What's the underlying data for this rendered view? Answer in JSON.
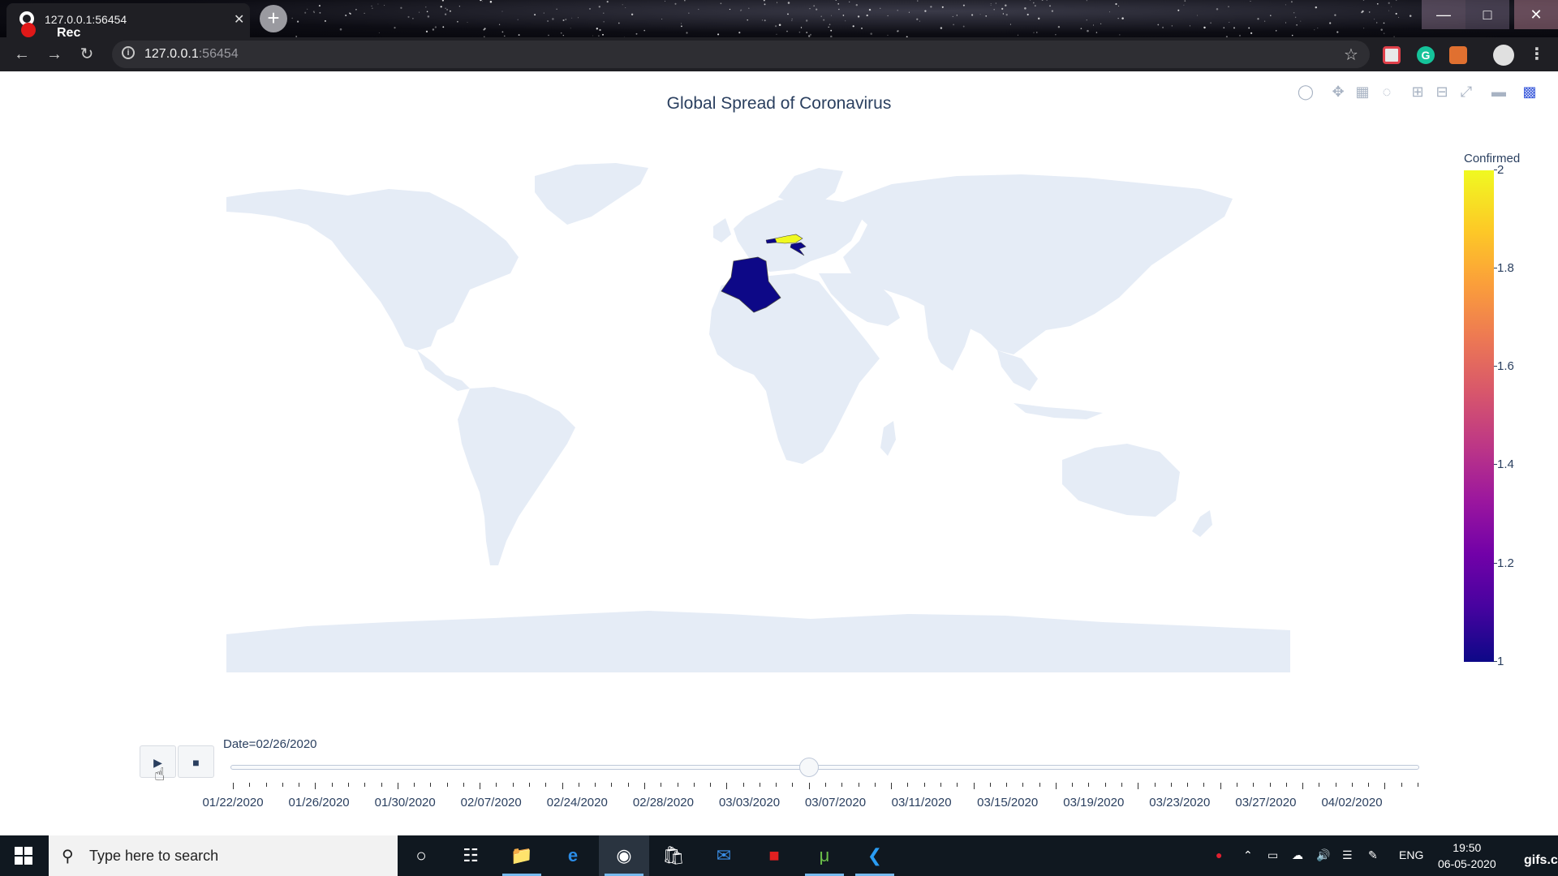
{
  "browser": {
    "tab_title": "127.0.0.1:56454",
    "rec_label": "Rec",
    "url_host": "127.0.0.1",
    "url_port": ":56454",
    "new_tab": "+",
    "tab_close": "✕"
  },
  "plot": {
    "title": "Global Spread of Coronavirus",
    "colorbar": {
      "title": "Confirmed",
      "ticks": [
        "2",
        "1.8",
        "1.6",
        "1.4",
        "1.2",
        "1"
      ],
      "colorscale": [
        "#0d0887",
        "#46039f",
        "#7201a8",
        "#9c179e",
        "#bd3786",
        "#d8576b",
        "#ed7953",
        "#fb9f3a",
        "#fdca26",
        "#f0f921"
      ]
    },
    "land_color": "#e5ecf6",
    "highlighted_countries": [
      {
        "name": "Algeria",
        "color": "#0d0887"
      },
      {
        "name": "Austria",
        "color": "#f0f921"
      },
      {
        "name": "Croatia",
        "color": "#0d0887"
      }
    ]
  },
  "animation": {
    "play_label": "▶",
    "stop_label": "■",
    "current_label": "Date=02/26/2020",
    "frame_count": 73,
    "current_frame": 35,
    "tick_labels": [
      "01/22/2020",
      "01/26/2020",
      "01/30/2020",
      "02/07/2020",
      "02/24/2020",
      "02/28/2020",
      "03/03/2020",
      "03/07/2020",
      "03/11/2020",
      "03/15/2020",
      "03/19/2020",
      "03/23/2020",
      "03/27/2020",
      "04/02/2020"
    ]
  },
  "taskbar": {
    "search_placeholder": "Type here to search",
    "language": "ENG",
    "time": "19:50",
    "date": "06-05-2020",
    "watermark": "gifs.com"
  }
}
